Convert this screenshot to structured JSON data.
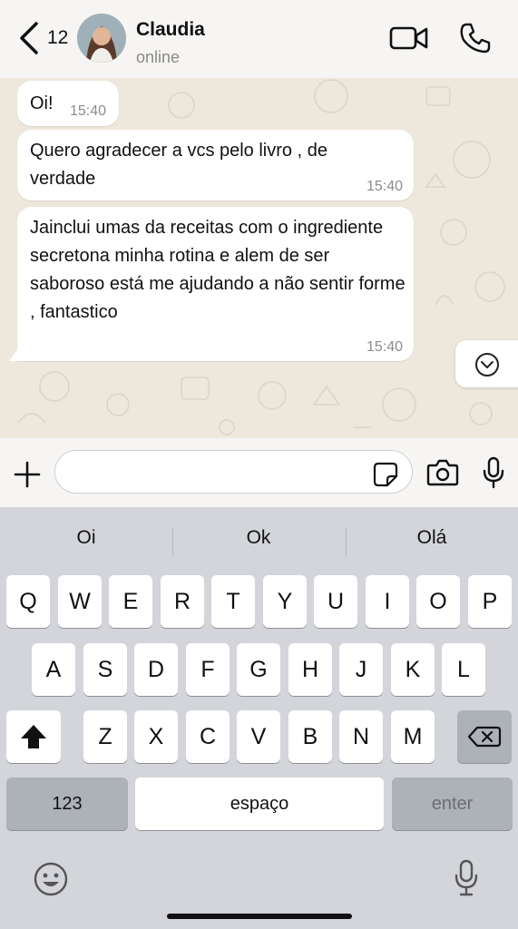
{
  "header": {
    "back_count": "12",
    "contact_name": "Claudia",
    "status": "online"
  },
  "messages": [
    {
      "text": "Oi!",
      "time": "15:40"
    },
    {
      "text": "Quero  agradecer  a vcs pelo  livro , de verdade",
      "time": "15:40"
    },
    {
      "text": "Jainclui  umas  da receitas  com  o ingrediente  secretona  minha  rotina  e alem  de ser saboroso  está me ajudando  a não sentir  forme , fantastico",
      "time": "15:40"
    }
  ],
  "composer": {
    "value": "",
    "placeholder": ""
  },
  "keyboard": {
    "suggestions": [
      "Oi",
      "Ok",
      "Olá"
    ],
    "row1": [
      "Q",
      "W",
      "E",
      "R",
      "T",
      "Y",
      "U",
      "I",
      "O",
      "P"
    ],
    "row2": [
      "A",
      "S",
      "D",
      "F",
      "G",
      "H",
      "J",
      "K",
      "L"
    ],
    "row3": [
      "Z",
      "X",
      "C",
      "V",
      "B",
      "N",
      "M"
    ],
    "numbers_key": "123",
    "space_key": "espaço",
    "enter_key": "enter"
  },
  "colors": {
    "chat_background": "#ede7dc",
    "bubble": "#ffffff",
    "keyboard_background": "#d3d5da"
  }
}
